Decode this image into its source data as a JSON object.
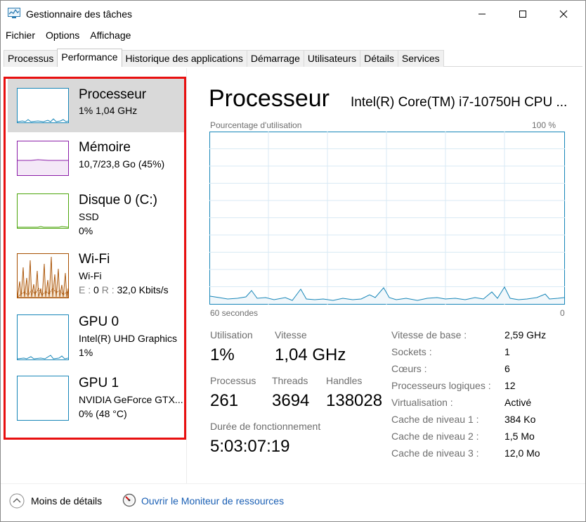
{
  "window": {
    "title": "Gestionnaire des tâches",
    "icon": "task-manager-icon"
  },
  "menu": [
    "Fichier",
    "Options",
    "Affichage"
  ],
  "tabs": [
    {
      "label": "Processus"
    },
    {
      "label": "Performance",
      "active": true
    },
    {
      "label": "Historique des applications"
    },
    {
      "label": "Démarrage"
    },
    {
      "label": "Utilisateurs"
    },
    {
      "label": "Détails"
    },
    {
      "label": "Services"
    }
  ],
  "resources": [
    {
      "name": "Processeur",
      "line1": "1%  1,04 GHz",
      "line2": "",
      "color": "#1786b8",
      "selected": true
    },
    {
      "name": "Mémoire",
      "line1": "10,7/23,8 Go (45%)",
      "line2": "",
      "color": "#8b1ea8"
    },
    {
      "name": "Disque 0 (C:)",
      "line1": "SSD",
      "line2": "0%",
      "color": "#4da60c"
    },
    {
      "name": "Wi-Fi",
      "line1": "Wi-Fi",
      "line2_e_label": "E :",
      "line2_e_value": "0",
      "line2_r_label": "R :",
      "line2_r_value": "32,0 Kbits/s",
      "color": "#a74f01"
    },
    {
      "name": "GPU 0",
      "line1": "Intel(R) UHD Graphics",
      "line2": "1%",
      "color": "#1786b8"
    },
    {
      "name": "GPU 1",
      "line1": "NVIDIA GeForce GTX...",
      "line2": "0%  (48 °C)",
      "color": "#1786b8"
    }
  ],
  "main": {
    "title": "Processeur",
    "cpu_model": "Intel(R) Core(TM) i7-10750H CPU ...",
    "graph_top_left": "Pourcentage d'utilisation",
    "graph_top_right": "100 %",
    "graph_bottom_left": "60 secondes",
    "graph_bottom_right": "0",
    "graph_color": "#1786b8",
    "stats": {
      "utilisation_label": "Utilisation",
      "utilisation_value": "1%",
      "vitesse_label": "Vitesse",
      "vitesse_value": "1,04 GHz",
      "processus_label": "Processus",
      "processus_value": "261",
      "threads_label": "Threads",
      "threads_value": "3694",
      "handles_label": "Handles",
      "handles_value": "138028",
      "uptime_label": "Durée de fonctionnement",
      "uptime_value": "5:03:07:19"
    },
    "specs": [
      {
        "label": "Vitesse de base :",
        "value": "2,59 GHz"
      },
      {
        "label": "Sockets :",
        "value": "1"
      },
      {
        "label": "Cœurs :",
        "value": "6"
      },
      {
        "label": "Processeurs logiques :",
        "value": "12"
      },
      {
        "label": "Virtualisation :",
        "value": "Activé"
      },
      {
        "label": "Cache de niveau 1 :",
        "value": "384 Ko"
      },
      {
        "label": "Cache de niveau 2 :",
        "value": "1,5 Mo"
      },
      {
        "label": "Cache de niveau 3 :",
        "value": "12,0 Mo"
      }
    ]
  },
  "footer": {
    "less_details": "Moins de détails",
    "monitor_link": "Ouvrir le Moniteur de ressources"
  }
}
